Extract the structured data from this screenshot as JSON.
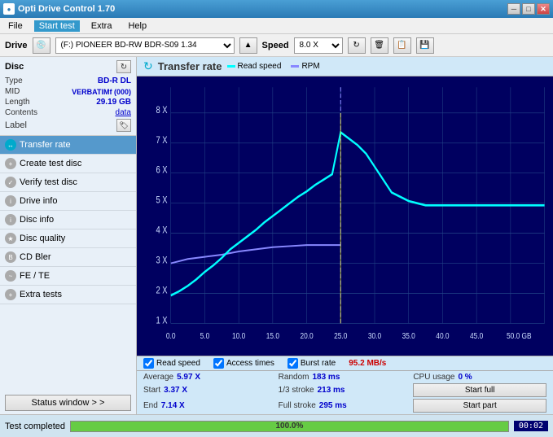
{
  "titleBar": {
    "title": "Opti Drive Control 1.70",
    "icon": "●",
    "minBtn": "─",
    "maxBtn": "□",
    "closeBtn": "✕"
  },
  "menuBar": {
    "items": [
      "File",
      "Start test",
      "Extra",
      "Help"
    ]
  },
  "driveBar": {
    "label": "Drive",
    "driveValue": "(F:)  PIONEER BD-RW  BDR-S09 1.34",
    "speedLabel": "Speed",
    "speedValue": "8.0 X"
  },
  "disc": {
    "title": "Disc",
    "refreshIcon": "↻",
    "fields": [
      {
        "key": "Type",
        "value": "BD-R DL"
      },
      {
        "key": "MID",
        "value": "VERBATIMf (000)"
      },
      {
        "key": "Length",
        "value": "29.19 GB"
      },
      {
        "key": "Contents",
        "value": "data"
      },
      {
        "key": "Label",
        "value": ""
      }
    ]
  },
  "nav": {
    "items": [
      {
        "label": "Transfer rate",
        "active": true
      },
      {
        "label": "Create test disc",
        "active": false
      },
      {
        "label": "Verify test disc",
        "active": false
      },
      {
        "label": "Drive info",
        "active": false
      },
      {
        "label": "Disc info",
        "active": false
      },
      {
        "label": "Disc quality",
        "active": false
      },
      {
        "label": "CD Bler",
        "active": false
      },
      {
        "label": "FE / TE",
        "active": false
      },
      {
        "label": "Extra tests",
        "active": false
      }
    ]
  },
  "statusWindowBtn": "Status window > >",
  "chart": {
    "title": "Transfer rate",
    "icon": "↻",
    "legend": {
      "readSpeed": "Read speed",
      "rpm": "RPM"
    },
    "yLabels": [
      "8 X",
      "7 X",
      "6 X",
      "5 X",
      "4 X",
      "3 X",
      "2 X",
      "1 X"
    ],
    "xLabels": [
      "0.0",
      "5.0",
      "10.0",
      "15.0",
      "20.0",
      "25.0",
      "30.0",
      "35.0",
      "40.0",
      "45.0",
      "50.0 GB"
    ]
  },
  "checkboxes": {
    "readSpeed": {
      "label": "Read speed",
      "checked": true
    },
    "accessTimes": {
      "label": "Access times",
      "checked": true
    },
    "burstRate": {
      "label": "Burst rate",
      "checked": true
    },
    "burstVal": "95.2 MB/s"
  },
  "stats": {
    "average": {
      "key": "Average",
      "value": "5.97 X"
    },
    "random": {
      "key": "Random",
      "value": "183 ms"
    },
    "cpuUsage": {
      "key": "CPU usage",
      "value": "0 %"
    },
    "start": {
      "key": "Start",
      "value": "3.37 X"
    },
    "oneThirdStroke": {
      "key": "1/3 stroke",
      "value": "213 ms"
    },
    "startFullBtn": "Start full",
    "end": {
      "key": "End",
      "value": "7.14 X"
    },
    "fullStroke": {
      "key": "Full stroke",
      "value": "295 ms"
    },
    "startPartBtn": "Start part"
  },
  "statusBar": {
    "testCompleted": "Test completed",
    "progressPercent": 100,
    "progressText": "100.0%",
    "time": "00:02"
  }
}
